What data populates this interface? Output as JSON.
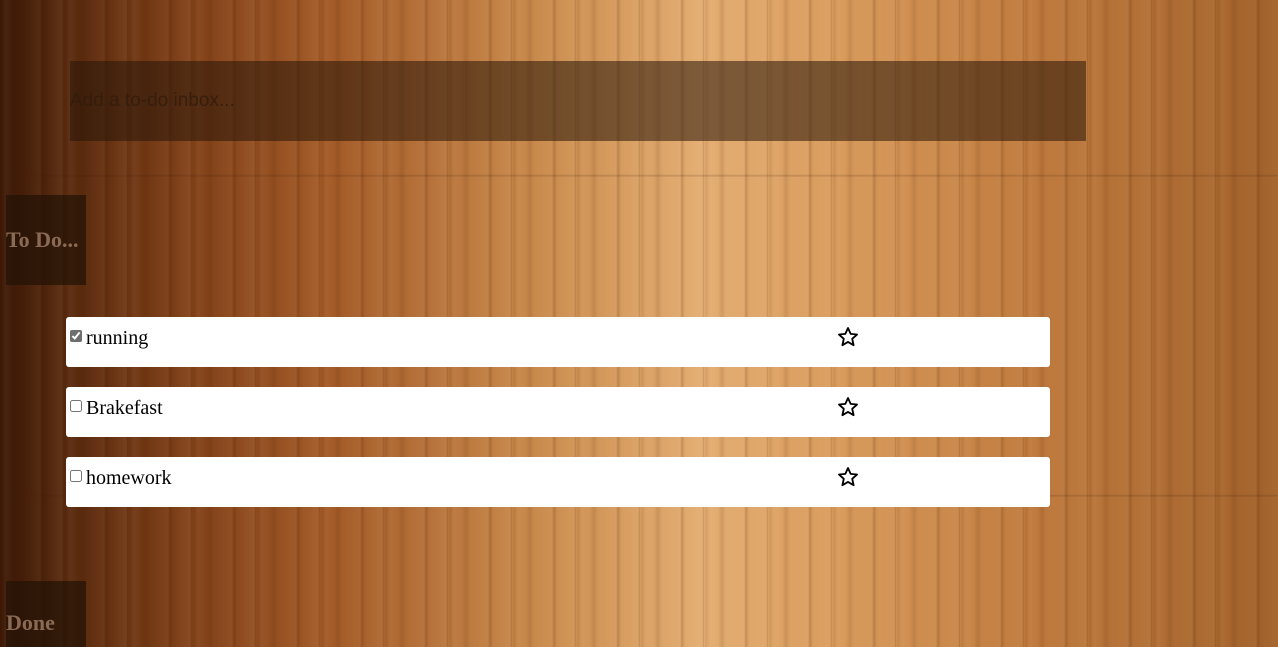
{
  "add_todo": {
    "placeholder": "Add a to-do inbox..."
  },
  "sections": {
    "todo_heading": "To Do...",
    "done_heading": "Done"
  },
  "todos": [
    {
      "label": "running",
      "checked": true,
      "starred": false,
      "star_icon": "star-outline-icon"
    },
    {
      "label": "Brakefast",
      "checked": false,
      "starred": false,
      "star_icon": "star-outline-icon"
    },
    {
      "label": "homework",
      "checked": false,
      "starred": false,
      "star_icon": "star-outline-icon"
    }
  ],
  "colors": {
    "heading_text": "#8b6a55",
    "heading_bg": "#23120699",
    "input_bg": "#2816 0a8c",
    "item_bg": "#ffffff"
  }
}
